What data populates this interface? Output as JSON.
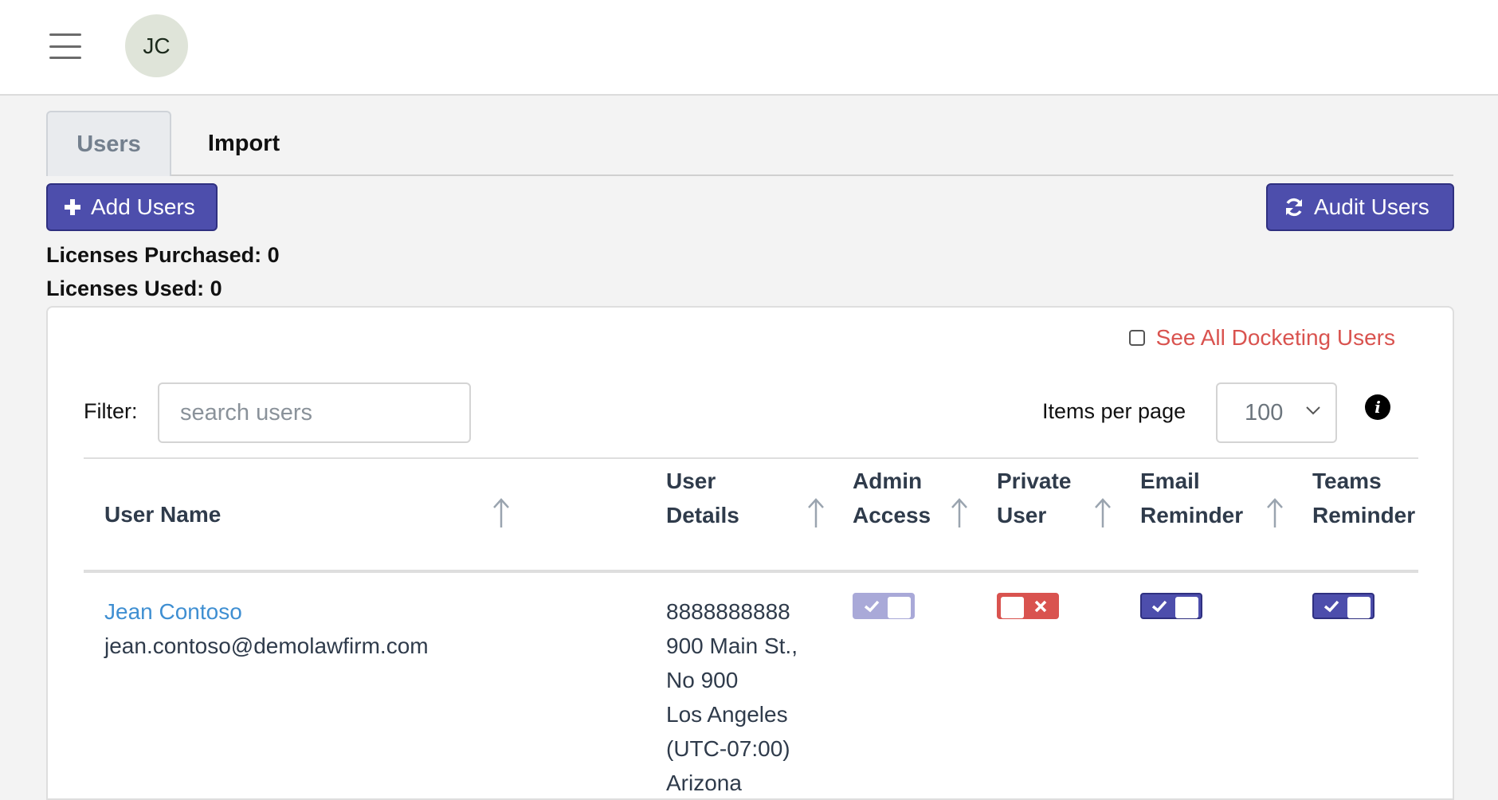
{
  "header": {
    "avatar_initials": "JC",
    "menu_icon": "hamburger-icon"
  },
  "tabs": [
    {
      "label": "Users",
      "active": true
    },
    {
      "label": "Import",
      "active": false
    }
  ],
  "toolbar": {
    "add_label": "Add Users",
    "audit_label": "Audit Users"
  },
  "licenses": {
    "purchased": "Licenses Purchased: 0",
    "used": "Licenses Used: 0"
  },
  "panel": {
    "see_all_label": "See All Docketing Users",
    "see_all_checked": false,
    "filter_label": "Filter:",
    "filter_placeholder": "search users",
    "filter_value": "",
    "items_per_page_label": "Items per page",
    "items_per_page_value": "100"
  },
  "table": {
    "columns": [
      {
        "line1": "User Name",
        "line2": ""
      },
      {
        "line1": "User",
        "line2": "Details"
      },
      {
        "line1": "Admin",
        "line2": "Access"
      },
      {
        "line1": "Private",
        "line2": "User"
      },
      {
        "line1": "Email",
        "line2": "Reminder"
      },
      {
        "line1": "Teams",
        "line2": "Reminder"
      }
    ],
    "rows": [
      {
        "name": "Jean Contoso",
        "email": "jean.contoso@demolawfirm.com",
        "details": [
          "8888888888",
          "900 Main St.,",
          "No 900",
          "Los Angeles",
          "(UTC-07:00)",
          "Arizona"
        ],
        "admin_access": true,
        "private_user": false,
        "email_reminder": true,
        "teams_reminder": true
      }
    ]
  },
  "colors": {
    "primary": "#4d4eac",
    "toggle_disabled_on": "#a9a9d8",
    "toggle_off": "#d9534f",
    "link": "#3f8fd2",
    "danger_text": "#d9534f"
  }
}
